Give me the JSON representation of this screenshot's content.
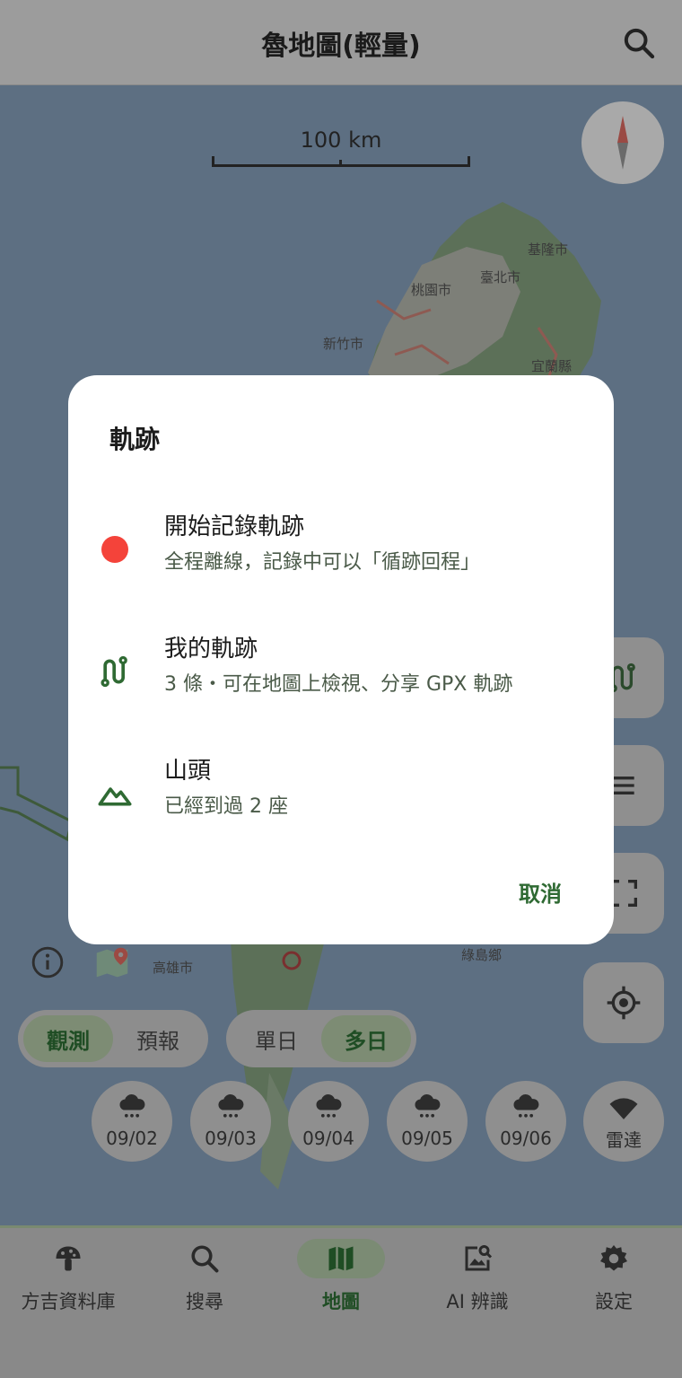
{
  "app": {
    "title": "魯地圖(輕量)"
  },
  "map": {
    "scale_label": "100 km",
    "cities": [
      "基隆市",
      "臺北市",
      "桃園市",
      "新竹市",
      "宜蘭縣",
      "高雄市",
      "綠島鄉"
    ]
  },
  "dialog": {
    "title": "軌跡",
    "items": [
      {
        "title": "開始記錄軌跡",
        "subtitle": "全程離線，記錄中可以「循跡回程」",
        "icon": "record-dot-icon"
      },
      {
        "title": "我的軌跡",
        "subtitle": "3 條・可在地圖上檢視、分享 GPX 軌跡",
        "icon": "track-route-icon"
      },
      {
        "title": "山頭",
        "subtitle": "已經到過 2 座",
        "icon": "mountain-icon"
      }
    ],
    "cancel_label": "取消"
  },
  "toggles": {
    "mode": {
      "options": [
        "觀測",
        "預報"
      ],
      "selected": "觀測"
    },
    "range": {
      "options": [
        "單日",
        "多日"
      ],
      "selected": "多日"
    }
  },
  "days": [
    {
      "label": "09/02",
      "icon": "rain-cloud-icon"
    },
    {
      "label": "09/03",
      "icon": "rain-cloud-icon"
    },
    {
      "label": "09/04",
      "icon": "rain-cloud-icon"
    },
    {
      "label": "09/05",
      "icon": "rain-cloud-icon"
    },
    {
      "label": "09/06",
      "icon": "rain-cloud-icon"
    },
    {
      "label": "雷達",
      "icon": "radar-icon"
    }
  ],
  "bottom_nav": [
    {
      "label": "方吉資料庫",
      "icon": "mushroom-icon"
    },
    {
      "label": "搜尋",
      "icon": "search-icon"
    },
    {
      "label": "地圖",
      "icon": "map-icon",
      "selected": true
    },
    {
      "label": "AI 辨識",
      "icon": "image-search-icon"
    },
    {
      "label": "設定",
      "icon": "gear-icon"
    }
  ],
  "colors": {
    "accent": "#2f6a33",
    "record": "#f4433a",
    "dialog_bg": "#ffffff"
  }
}
